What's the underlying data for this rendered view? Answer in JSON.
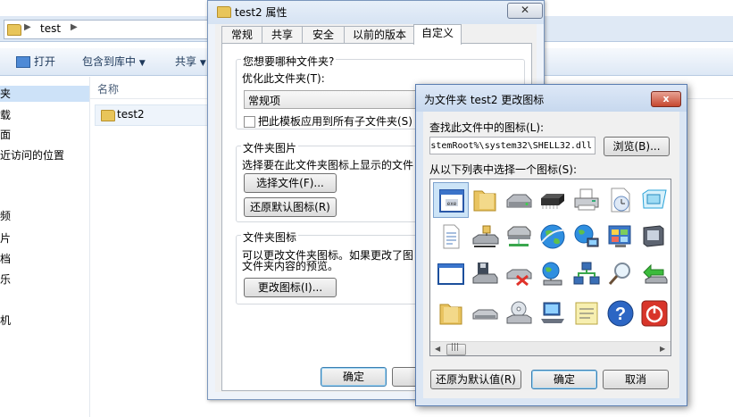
{
  "explorer": {
    "breadcrumb": "test",
    "toolbar": {
      "open": "打开",
      "include_library": "包含到库中",
      "share": "共享"
    },
    "nav_items": [
      "夹",
      "载",
      "面",
      "近访问的位置",
      "频",
      "片",
      "档",
      "乐",
      "机"
    ],
    "column_header": "名称",
    "files": [
      {
        "name": "test2"
      }
    ]
  },
  "properties": {
    "title": "test2 属性",
    "tabs": [
      "常规",
      "共享",
      "安全",
      "以前的版本",
      "自定义"
    ],
    "active_tab": "自定义",
    "group1": {
      "title": "您想要哪种文件夹?",
      "optimize_label": "优化此文件夹(T):",
      "optimize_value": "常规项",
      "apply_subfolders": "把此模板应用到所有子文件夹(S)"
    },
    "group2": {
      "title": "文件夹图片",
      "desc": "选择要在此文件夹图标上显示的文件",
      "choose_file": "选择文件(F)...",
      "restore_default": "还原默认图标(R)"
    },
    "group3": {
      "title": "文件夹图标",
      "desc_line1": "可以更改文件夹图标。如果更改了图",
      "desc_line2": "文件夹内容的预览。",
      "change_icon": "更改图标(I)..."
    },
    "ok": "确定"
  },
  "change_icon_dialog": {
    "title": "为文件夹 test2 更改图标",
    "close": "x",
    "find_label": "查找此文件中的图标(L):",
    "path_value": "stemRoot%\\system32\\SHELL32.dll",
    "browse": "浏览(B)...",
    "list_label": "从以下列表中选择一个图标(S):",
    "scroll_thumb": "|||",
    "restore_default": "还原为默认值(R)",
    "ok": "确定",
    "cancel": "取消"
  },
  "colors": {
    "window_border": "#5a7db0",
    "title_bg": "#dbe6f4",
    "selection": "#cce4f7",
    "close_red": "#c6472f"
  },
  "icons": [
    [
      "blank-window-icon",
      "folder-icon",
      "hard-drive-icon",
      "memory-chip-icon",
      "printer-icon",
      "clock-document-icon",
      "screen-icon"
    ],
    [
      "text-document-icon",
      "network-drive-icon",
      "network-server-icon",
      "globe-icon",
      "network-globe-icon",
      "control-panel-icon",
      "monitor-icon"
    ],
    [
      "window-icon",
      "floppy-icon",
      "disconnected-drive-icon",
      "world-network-icon",
      "network-computers-icon",
      "search-icon",
      "green-arrow-icon"
    ],
    [
      "folder-icon",
      "drive-icon",
      "cd-drive-icon",
      "computer-icon",
      "notes-icon",
      "help-icon",
      "power-icon"
    ]
  ]
}
